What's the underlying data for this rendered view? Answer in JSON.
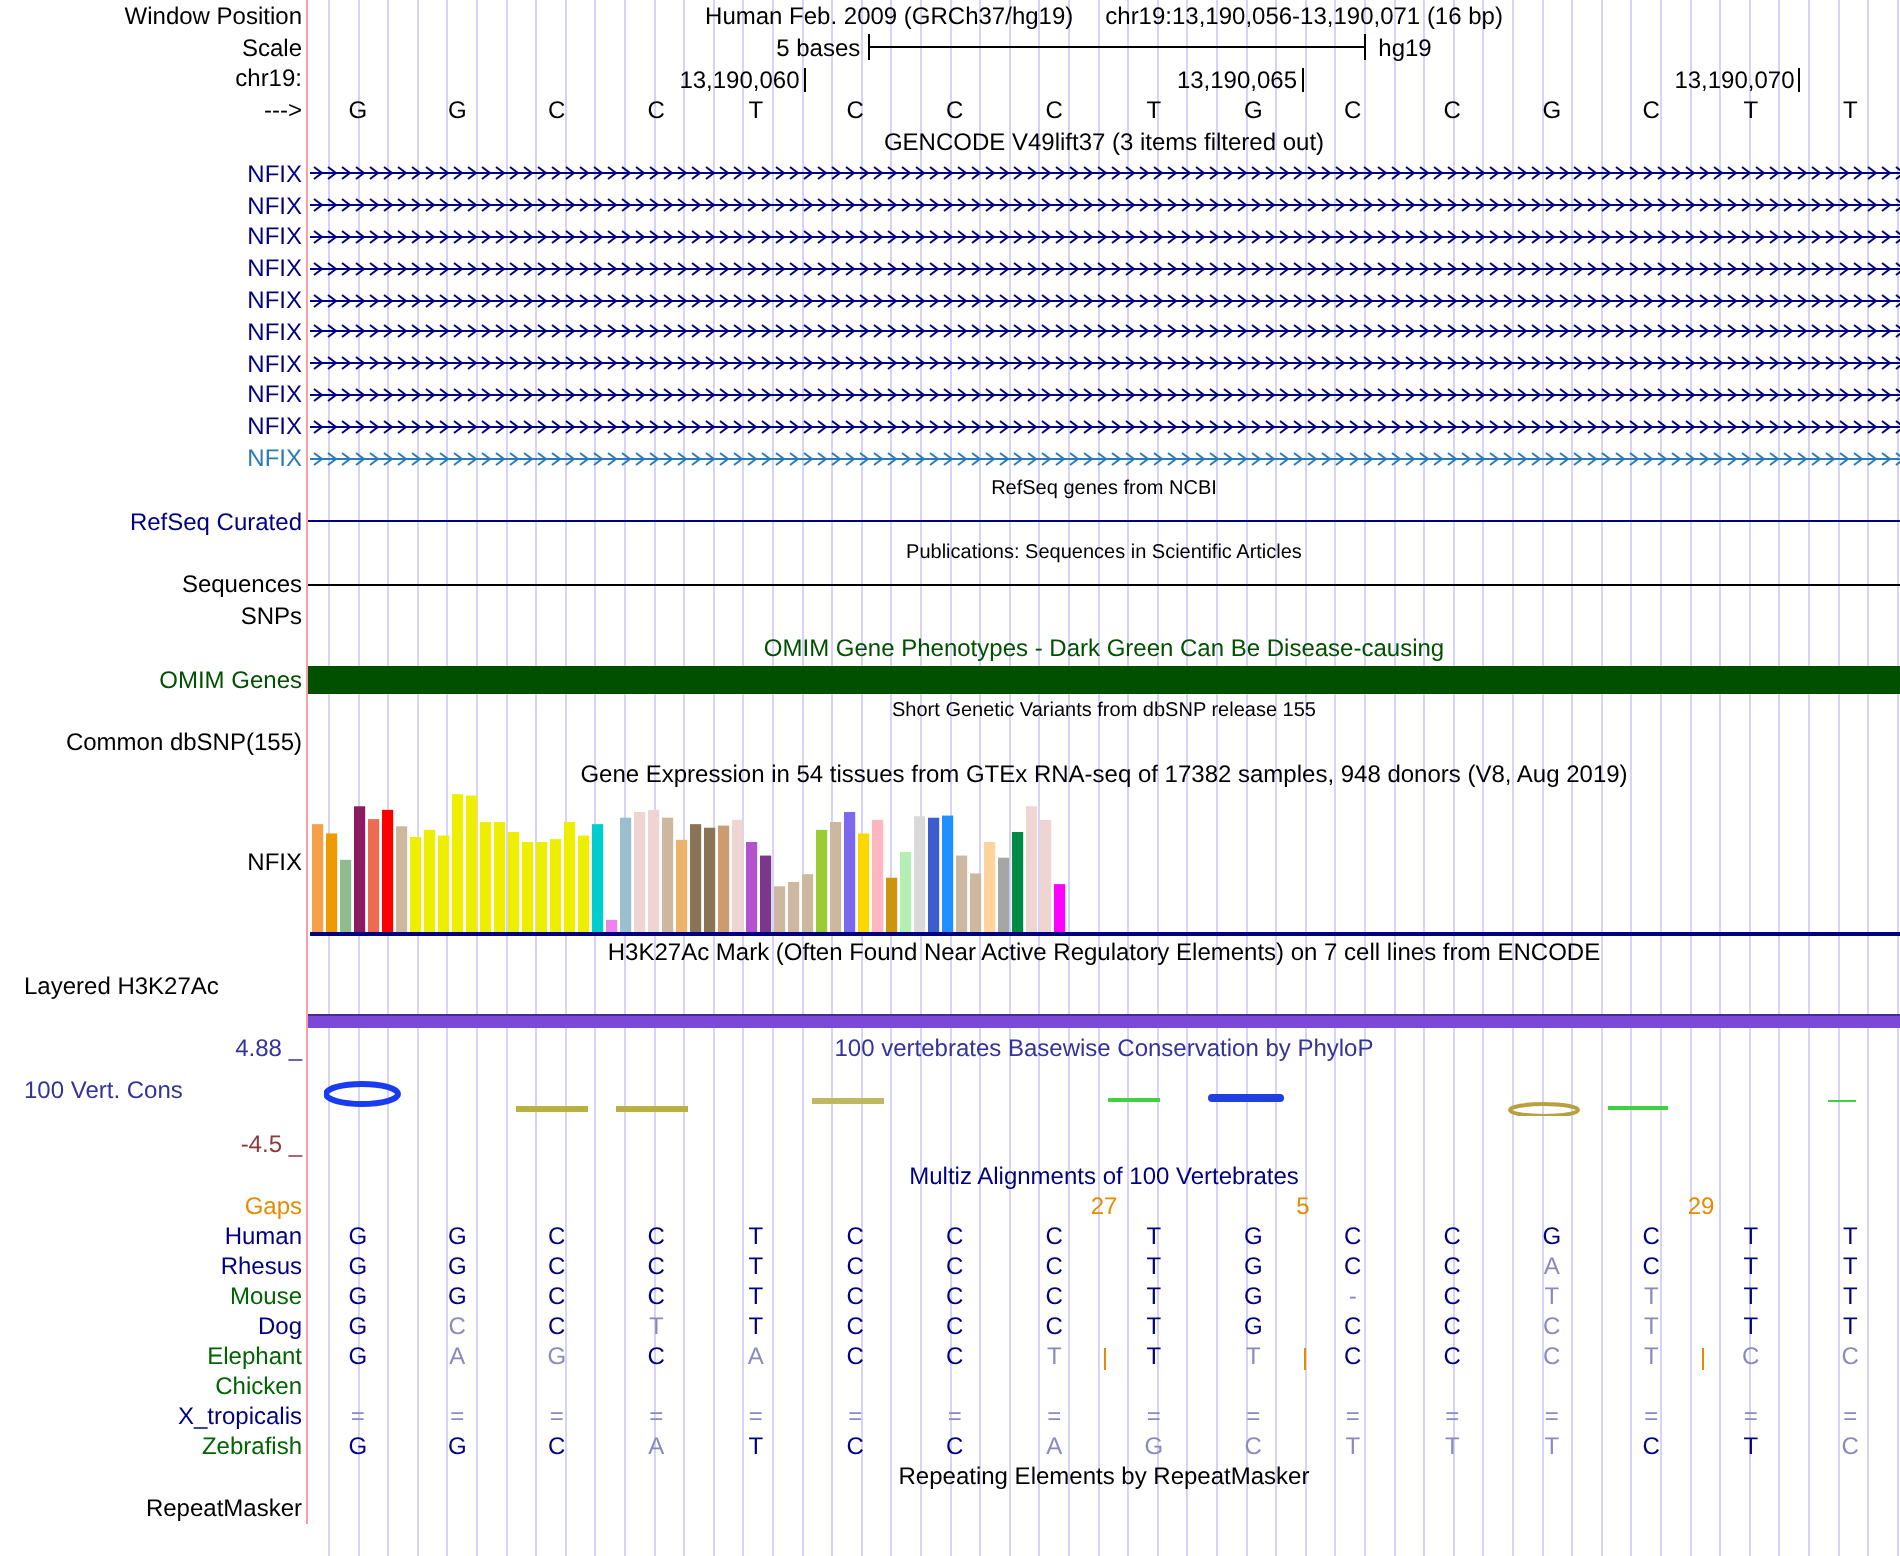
{
  "header": {
    "position_label": "Window Position",
    "assembly_text": "Human Feb. 2009 (GRCh37/hg19)",
    "range_text": "chr19:13,190,056-13,190,071 (16 bp)",
    "scale_label": "Scale",
    "scale_text": "5 bases",
    "scale_assembly": "hg19",
    "chrom_label": "chr19:",
    "ruler_ticks": [
      "13,190,060",
      "13,190,065",
      "13,190,070"
    ],
    "strand_label": "--->",
    "bases": [
      "G",
      "G",
      "C",
      "C",
      "T",
      "C",
      "C",
      "C",
      "T",
      "G",
      "C",
      "C",
      "G",
      "C",
      "T",
      "T"
    ]
  },
  "tracks": [
    {
      "kind": "title",
      "text": "GENCODE V49lift37 (3 items filtered out)",
      "color": "#000000"
    },
    {
      "kind": "gene",
      "label": "NFIX",
      "color": "#000080"
    },
    {
      "kind": "gene",
      "label": "NFIX",
      "color": "#000080"
    },
    {
      "kind": "gene",
      "label": "NFIX",
      "color": "#000080"
    },
    {
      "kind": "gene",
      "label": "NFIX",
      "color": "#000080"
    },
    {
      "kind": "gene",
      "label": "NFIX",
      "color": "#000080"
    },
    {
      "kind": "gene",
      "label": "NFIX",
      "color": "#000080"
    },
    {
      "kind": "gene",
      "label": "NFIX",
      "color": "#000080"
    },
    {
      "kind": "gene",
      "label": "NFIX",
      "color": "#000080"
    },
    {
      "kind": "gene",
      "label": "NFIX",
      "color": "#000080"
    },
    {
      "kind": "gene",
      "label": "NFIX",
      "color": "#2a7ab8"
    },
    {
      "kind": "note",
      "text": "RefSeq genes from NCBI"
    },
    {
      "kind": "line",
      "label": "RefSeq Curated",
      "color": "#000080"
    },
    {
      "kind": "note",
      "text": "Publications: Sequences in Scientific Articles"
    },
    {
      "kind": "line",
      "label": "Sequences",
      "color": "#000000"
    },
    {
      "kind": "empty",
      "label": "SNPs"
    },
    {
      "kind": "title",
      "text": "OMIM Gene Phenotypes - Dark Green Can Be Disease-causing",
      "color": "#005000"
    },
    {
      "kind": "bar",
      "label": "OMIM Genes",
      "color": "#005000"
    },
    {
      "kind": "note",
      "text": "Short Genetic Variants from dbSNP release 155"
    },
    {
      "kind": "empty",
      "label": "Common dbSNP(155)"
    },
    {
      "kind": "title",
      "text": "Gene Expression in 54 tissues from GTEx RNA-seq of 17382 samples, 948 donors (V8, Aug 2019)",
      "color": "#000000"
    },
    {
      "kind": "expression",
      "label": "NFIX"
    },
    {
      "kind": "title",
      "text": "H3K27Ac Mark (Often Found Near Active Regulatory Elements) on 7 cell lines from ENCODE",
      "color": "#000000"
    },
    {
      "kind": "layered",
      "label": "Layered H3K27Ac",
      "color": "#7c48d8"
    },
    {
      "kind": "conservation",
      "title": "100 vertebrates Basewise Conservation by PhyloP",
      "label": "100 Vert. Cons",
      "max": "4.88 _",
      "min": "-4.5 _"
    },
    {
      "kind": "title",
      "text": "Multiz Alignments of 100 Vertebrates",
      "color": "#000080"
    },
    {
      "kind": "alignment",
      "gaps_label": "Gaps",
      "gaps": [
        {
          "insert": false
        },
        {
          "insert": false
        },
        {
          "insert": false
        },
        {
          "insert": false
        },
        {
          "insert": false
        },
        {
          "insert": false
        },
        {
          "insert": false
        },
        {
          "insert": true,
          "text": "27"
        },
        {
          "insert": false
        },
        {
          "insert": true,
          "text": "5"
        },
        {
          "insert": false
        },
        {
          "insert": false
        },
        {
          "insert": false
        },
        {
          "insert": true,
          "text": "29"
        },
        {
          "insert": false
        },
        {
          "insert": false
        }
      ],
      "species": [
        {
          "name": "Human",
          "color": "#000080",
          "bases": [
            "G",
            "G",
            "C",
            "C",
            "T",
            "C",
            "C",
            "C",
            "T",
            "G",
            "C",
            "C",
            "G",
            "C",
            "T",
            "T"
          ],
          "mismatch": [
            false,
            false,
            false,
            false,
            false,
            false,
            false,
            false,
            false,
            false,
            false,
            false,
            false,
            false,
            false,
            false
          ]
        },
        {
          "name": "Rhesus",
          "color": "#000080",
          "bases": [
            "G",
            "G",
            "C",
            "C",
            "T",
            "C",
            "C",
            "C",
            "T",
            "G",
            "C",
            "C",
            "A",
            "C",
            "T",
            "T"
          ],
          "mismatch": [
            false,
            false,
            false,
            false,
            false,
            false,
            false,
            false,
            false,
            false,
            false,
            false,
            true,
            false,
            false,
            false
          ]
        },
        {
          "name": "Mouse",
          "color": "#006400",
          "bases": [
            "G",
            "G",
            "C",
            "C",
            "T",
            "C",
            "C",
            "C",
            "T",
            "G",
            "-",
            "C",
            "T",
            "T",
            "T",
            "T"
          ],
          "mismatch": [
            false,
            false,
            false,
            false,
            false,
            false,
            false,
            false,
            false,
            false,
            true,
            false,
            true,
            true,
            false,
            false
          ]
        },
        {
          "name": "Dog",
          "color": "#000080",
          "bases": [
            "G",
            "C",
            "C",
            "T",
            "T",
            "C",
            "C",
            "C",
            "T",
            "G",
            "C",
            "C",
            "C",
            "T",
            "T",
            "T"
          ],
          "mismatch": [
            false,
            true,
            false,
            true,
            false,
            false,
            false,
            false,
            false,
            false,
            false,
            false,
            true,
            true,
            false,
            false
          ]
        },
        {
          "name": "Elephant",
          "color": "#006400",
          "bases": [
            "G",
            "A",
            "G",
            "C",
            "A",
            "C",
            "C",
            "T",
            "T",
            "T",
            "C",
            "C",
            "C",
            "T",
            "C",
            "C"
          ],
          "mismatch": [
            false,
            true,
            true,
            false,
            true,
            false,
            false,
            true,
            false,
            true,
            false,
            false,
            true,
            true,
            true,
            true
          ],
          "inserts": [
            false,
            false,
            false,
            false,
            false,
            false,
            false,
            true,
            false,
            true,
            false,
            false,
            false,
            true,
            false,
            false
          ]
        },
        {
          "name": "Chicken",
          "color": "#006400"
        },
        {
          "name": "X_tropicalis",
          "color": "#000080",
          "bases": [
            "=",
            "=",
            "=",
            "=",
            "=",
            "=",
            "=",
            "=",
            "=",
            "=",
            "=",
            "=",
            "=",
            "=",
            "=",
            "="
          ],
          "mismatch": [
            true,
            true,
            true,
            true,
            true,
            true,
            true,
            true,
            true,
            true,
            true,
            true,
            true,
            true,
            true,
            true
          ]
        },
        {
          "name": "Zebrafish",
          "color": "#006400",
          "bases": [
            "G",
            "G",
            "C",
            "A",
            "T",
            "C",
            "C",
            "A",
            "G",
            "C",
            "T",
            "T",
            "T",
            "C",
            "T",
            "C"
          ],
          "mismatch": [
            false,
            false,
            false,
            true,
            false,
            false,
            false,
            true,
            true,
            true,
            true,
            true,
            true,
            false,
            false,
            true
          ]
        }
      ]
    },
    {
      "kind": "title",
      "text": "Repeating Elements by RepeatMasker",
      "color": "#000000"
    },
    {
      "kind": "empty",
      "label": "RepeatMasker"
    }
  ]
}
